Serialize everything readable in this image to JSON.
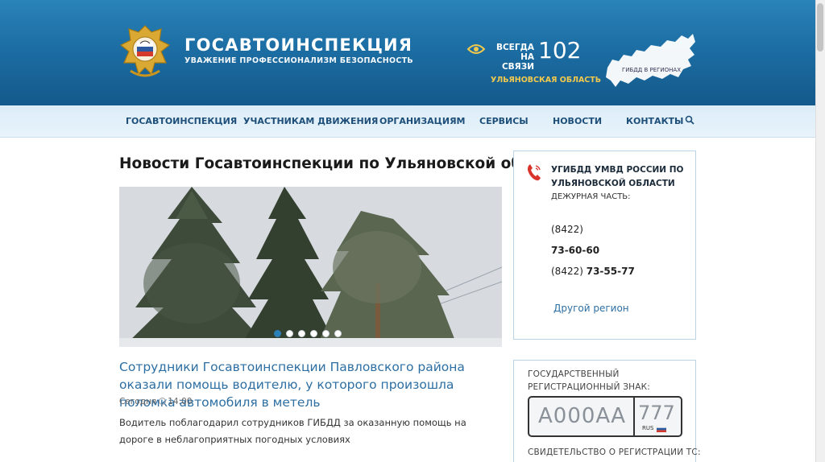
{
  "header": {
    "brand_title": "ГОСАВТОИНСПЕКЦИЯ",
    "brand_subtitle": "УВАЖЕНИЕ ПРОФЕССИОНАЛИЗМ БЕЗОПАСНОСТЬ",
    "always_line1": "ВСЕГДА",
    "always_line2": "НА СВЯЗИ",
    "hotline": "102",
    "region": "УЛЬЯНОВСКАЯ ОБЛАСТЬ",
    "map_label": "ГИБДД В РЕГИОНАХ",
    "icons": [
      "emblem-icon",
      "eye-icon",
      "russia-map-icon"
    ]
  },
  "nav": {
    "items": [
      "ГОСАВТОИНСПЕКЦИЯ",
      "УЧАСТНИКАМ ДВИЖЕНИЯ",
      "ОРГАНИЗАЦИЯМ",
      "СЕРВИСЫ",
      "НОВОСТИ",
      "КОНТАКТЫ"
    ],
    "search_icon": "search-icon"
  },
  "main": {
    "page_title": "Новости Госавтоинспекции по Ульяновской области",
    "slider_dots": 6,
    "slider_active_index": 0,
    "news": {
      "title": "Сотрудники Госавтоинспекции Павловского района оказали помощь водителю, у которого произошла поломка автомобиля в метель",
      "date_label": "Сегодня",
      "time": "14:00",
      "text": "Водитель поблагодарил сотрудников ГИБДД за оказанную помощь на дороге в неблагоприятных погодных условиях"
    }
  },
  "sidebar": {
    "contact": {
      "org_line1": "УГИБДД УМВД РОССИИ ПО",
      "org_line2": "УЛЬЯНОВСКОЙ ОБЛАСТИ",
      "duty_label": "ДЕЖУРНАЯ ЧАСТЬ:",
      "code1": "(8422)",
      "phone1": "73-60-60",
      "code2": "(8422)",
      "phone2": "73-55-77",
      "other_region": "Другой регион"
    },
    "plate": {
      "label_line1": "ГОСУДАРСТВЕННЫЙ",
      "label_line2": "РЕГИСТРАЦИОННЫЙ ЗНАК:",
      "number": "А000АА",
      "region_code": "777",
      "country": "RUS",
      "certificate_label": "СВИДЕТЕЛЬСТВО О РЕГИСТРАЦИИ ТС:"
    }
  },
  "colors": {
    "header_blue": "#1c6ea4",
    "nav_bg": "#e2f0f9",
    "link_blue": "#2d6fa3",
    "accent_gold": "#f2c94c",
    "phone_red": "#d9342b"
  }
}
